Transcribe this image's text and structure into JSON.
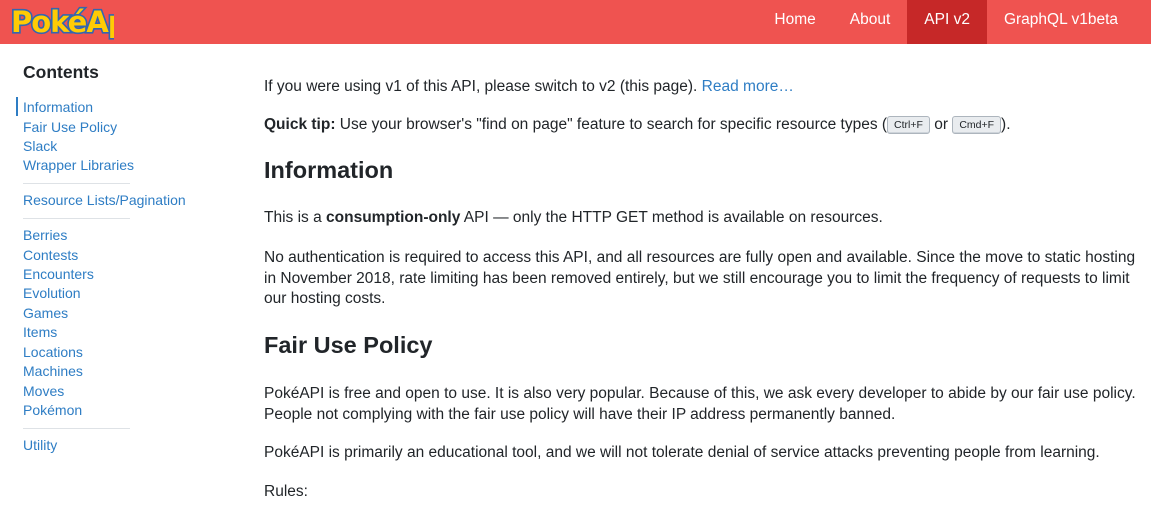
{
  "brand": {
    "logo_text": "PokéApi"
  },
  "nav": {
    "items": [
      {
        "label": "Home",
        "active": false
      },
      {
        "label": "About",
        "active": false
      },
      {
        "label": "API v2",
        "active": true
      },
      {
        "label": "GraphQL v1beta",
        "active": false
      }
    ]
  },
  "sidebar": {
    "title": "Contents",
    "groups": [
      [
        "Information",
        "Fair Use Policy",
        "Slack",
        "Wrapper Libraries"
      ],
      [
        "Resource Lists/Pagination"
      ],
      [
        "Berries",
        "Contests",
        "Encounters",
        "Evolution",
        "Games",
        "Items",
        "Locations",
        "Machines",
        "Moves",
        "Pokémon"
      ],
      [
        "Utility"
      ]
    ]
  },
  "content": {
    "notice_text": "If you were using v1 of this API, please switch to v2 (this page). ",
    "notice_link": "Read more…",
    "tip_label": "Quick tip:",
    "tip_text_1": " Use your browser's \"find on page\" feature to search for specific resource types (",
    "tip_key_1": "Ctrl+F",
    "tip_or": " or ",
    "tip_key_2": "Cmd+F",
    "tip_text_2": ").",
    "info_heading": "Information",
    "info_p1_a": "This is a ",
    "info_p1_bold": "consumption-only",
    "info_p1_b": " API — only the HTTP GET method is available on resources.",
    "info_p2": "No authentication is required to access this API, and all resources are fully open and available. Since the move to static hosting in November 2018, rate limiting has been removed entirely, but we still encourage you to limit the frequency of requests to limit our hosting costs.",
    "fair_heading": "Fair Use Policy",
    "fair_p1": "PokéAPI is free and open to use. It is also very popular. Because of this, we ask every developer to abide by our fair use policy. People not complying with the fair use policy will have their IP address permanently banned.",
    "fair_p2": "PokéAPI is primarily an educational tool, and we will not tolerate denial of service attacks preventing people from learning.",
    "rules_label": "Rules:"
  },
  "colors": {
    "navbar": "#ef5350",
    "nav_active": "#c62828",
    "link": "#2e7dc4",
    "logo_fill": "#ffcb05",
    "logo_stroke": "#3466af"
  }
}
